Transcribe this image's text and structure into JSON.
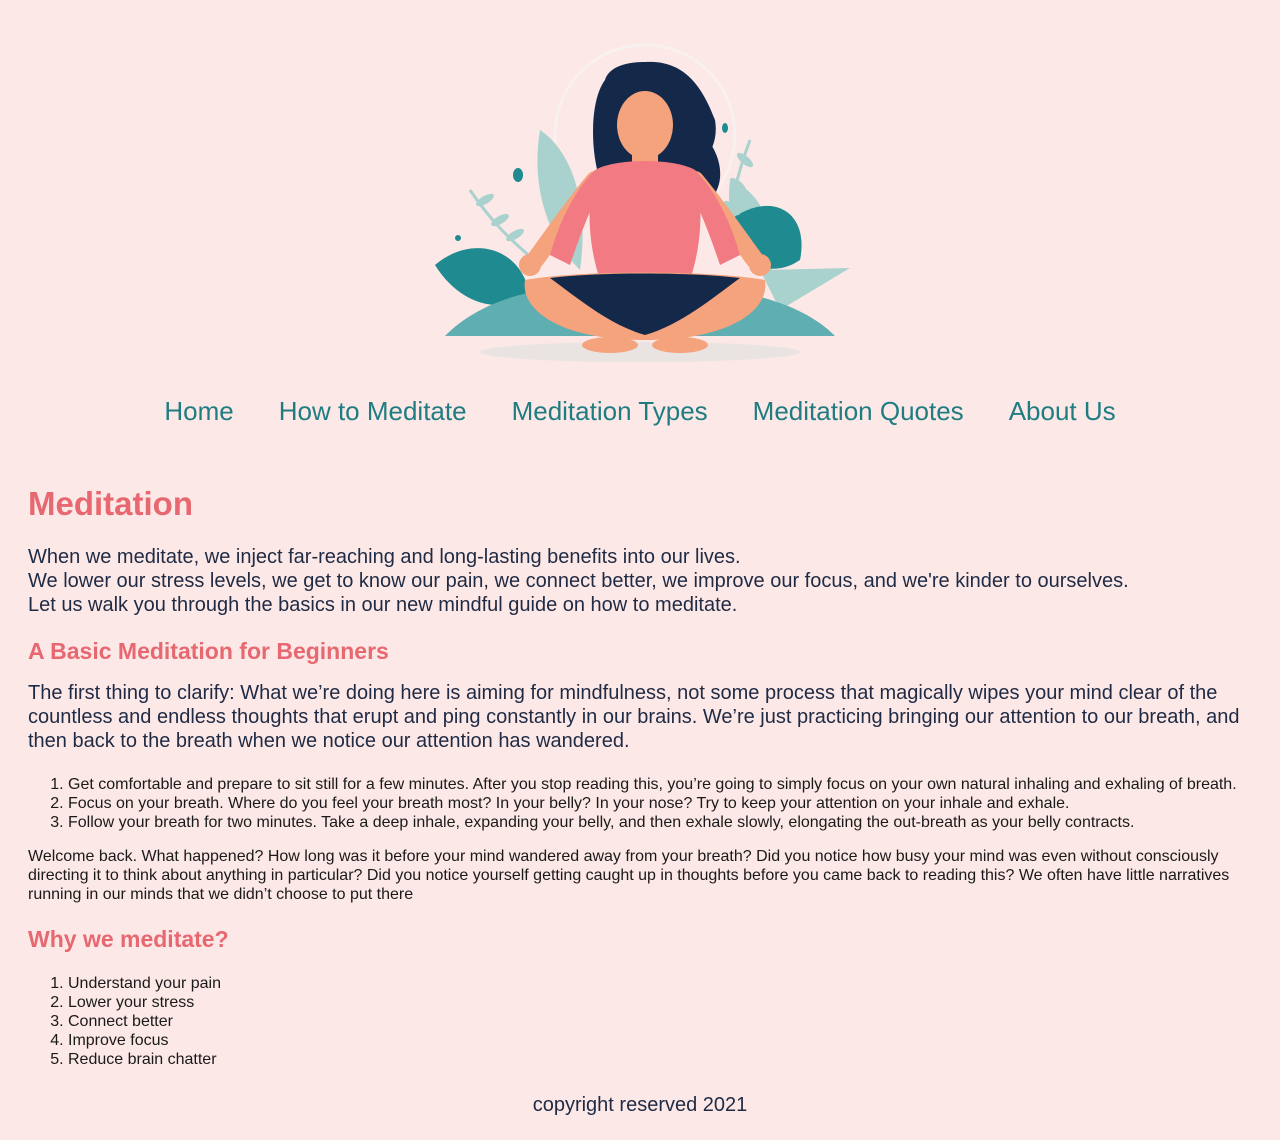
{
  "colors": {
    "background": "#fce8e6",
    "heading": "#e76870",
    "nav_link": "#1f7d82",
    "body_text": "#1f2a44"
  },
  "hero": {
    "icon": "meditating-woman-illustration"
  },
  "nav": {
    "items": [
      {
        "label": "Home"
      },
      {
        "label": "How to Meditate"
      },
      {
        "label": "Meditation Types"
      },
      {
        "label": "Meditation Quotes"
      },
      {
        "label": "About Us"
      }
    ]
  },
  "main": {
    "title": "Meditation",
    "intro": [
      "When we meditate, we inject far-reaching and long-lasting benefits into our lives.",
      "We lower our stress levels, we get to know our pain, we connect better, we improve our focus, and we're kinder to ourselves.",
      "Let us walk you through the basics in our new mindful guide on how to meditate."
    ],
    "basic_heading": "A Basic Meditation for Beginners",
    "basic_paragraph": "The first thing to clarify: What we’re doing here is aiming for mindfulness, not some process that magically wipes your mind clear of the countless and endless thoughts that erupt and ping constantly in our brains. We’re just practicing bringing our attention to our breath, and then back to the breath when we notice our attention has wandered.",
    "steps": [
      "Get comfortable and prepare to sit still for a few minutes. After you stop reading this, you’re going to simply focus on your own natural inhaling and exhaling of breath.",
      "Focus on your breath. Where do you feel your breath most? In your belly? In your nose? Try to keep your attention on your inhale and exhale.",
      "Follow your breath for two minutes. Take a deep inhale, expanding your belly, and then exhale slowly, elongating the out-breath as your belly contracts."
    ],
    "welcome_paragraph": "Welcome back. What happened? How long was it before your mind wandered away from your breath? Did you notice how busy your mind was even without consciously directing it to think about anything in particular? Did you notice yourself getting caught up in thoughts before you came back to reading this? We often have little narratives running in our minds that we didn’t choose to put there",
    "why_heading": "Why we meditate?",
    "reasons": [
      "Understand your pain",
      "Lower your stress",
      "Connect better",
      "Improve focus",
      "Reduce brain chatter"
    ]
  },
  "footer": {
    "text": "copyright reserved 2021"
  }
}
